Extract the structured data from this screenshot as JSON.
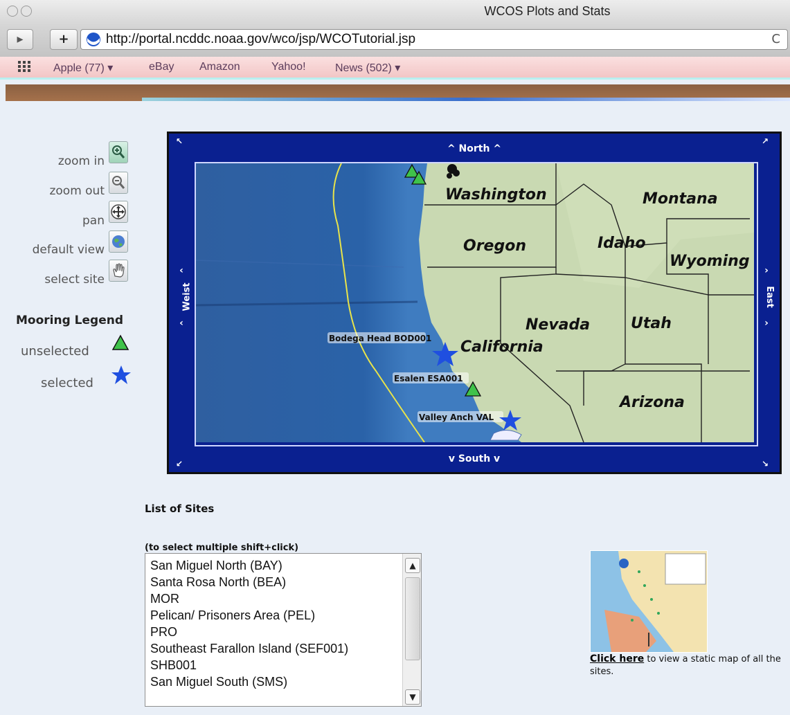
{
  "window": {
    "title": "WCOS Plots and Stats"
  },
  "browser": {
    "url": "http://portal.ncddc.noaa.gov/wco/jsp/WCOTutorial.jsp",
    "add_label": "+",
    "reload_label": "C",
    "bookmarks": [
      "Apple (77) ▾",
      "eBay",
      "Amazon",
      "Yahoo!",
      "News (502) ▾"
    ]
  },
  "map_nav": {
    "north": "^ North ^",
    "south": "v South v",
    "west": "Weist",
    "east": "East"
  },
  "tools": [
    {
      "label": "zoom in",
      "icon": "zoom-in-icon"
    },
    {
      "label": "zoom out",
      "icon": "zoom-out-icon"
    },
    {
      "label": "pan",
      "icon": "pan-icon"
    },
    {
      "label": "default view",
      "icon": "globe-icon"
    },
    {
      "label": "select site",
      "icon": "hand-icon"
    }
  ],
  "legend": {
    "title": "Mooring Legend",
    "unselected": "unselected",
    "selected": "selected"
  },
  "map": {
    "states": [
      "Washington",
      "Montana",
      "Oregon",
      "Idaho",
      "Wyoming",
      "Nevada",
      "Utah",
      "California",
      "Arizona"
    ],
    "site_labels": [
      "Bodega Head BOD001",
      "Esalen ESA001",
      "Valley Anch VAL"
    ]
  },
  "sites": {
    "title": "List of Sites",
    "hint": "(to select multiple shift+click)",
    "items": [
      "San Miguel North (BAY)",
      "Santa Rosa North (BEA)",
      "MOR",
      "Pelican/ Prisoners Area (PEL)",
      "PRO",
      "Southeast Farallon Island (SEF001)",
      "SHB001",
      "San Miguel South (SMS)"
    ]
  },
  "static_map": {
    "link_text": "Click here",
    "rest_text": " to view a static map of all the sites."
  },
  "colors": {
    "map_frame": "#0a2090",
    "selected_star": "#1f4fe0",
    "unselected_triangle": "#3fc24a"
  }
}
